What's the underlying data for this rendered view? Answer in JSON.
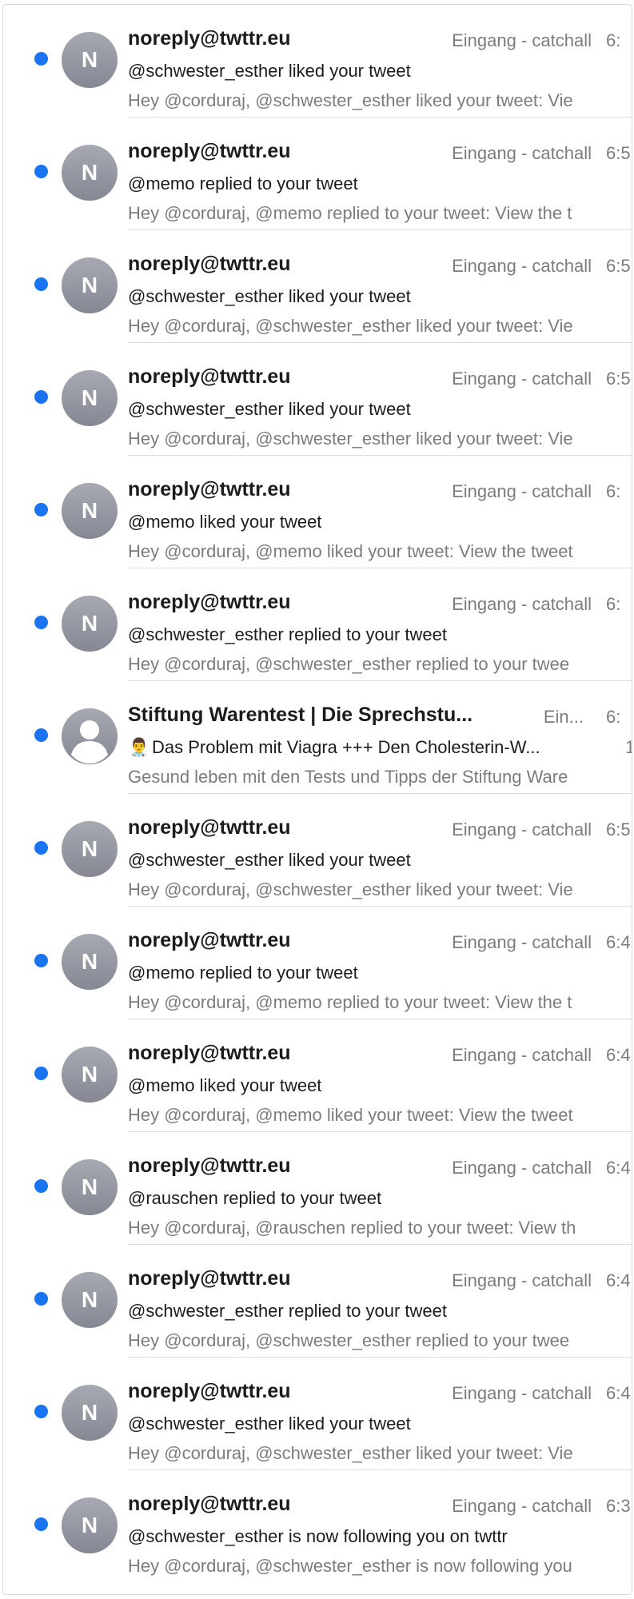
{
  "messages": [
    {
      "sender": "noreply@twttr.eu",
      "mailbox": "Eingang - catchall",
      "time": "6:",
      "subject": "@schwester_esther liked your tweet",
      "preview": "Hey @corduraj, @schwester_esther liked your tweet: Vie",
      "avatar_initial": "N",
      "unread": true
    },
    {
      "sender": "noreply@twttr.eu",
      "mailbox": "Eingang - catchall",
      "time": "6:5",
      "subject": "@memo replied to your tweet",
      "preview": "Hey @corduraj, @memo replied to your tweet: View the t",
      "avatar_initial": "N",
      "unread": true
    },
    {
      "sender": "noreply@twttr.eu",
      "mailbox": "Eingang - catchall",
      "time": "6:5",
      "subject": "@schwester_esther liked your tweet",
      "preview": "Hey @corduraj, @schwester_esther liked your tweet: Vie",
      "avatar_initial": "N",
      "unread": true
    },
    {
      "sender": "noreply@twttr.eu",
      "mailbox": "Eingang - catchall",
      "time": "6:5",
      "subject": "@schwester_esther liked your tweet",
      "preview": "Hey @corduraj, @schwester_esther liked your tweet: Vie",
      "avatar_initial": "N",
      "unread": true
    },
    {
      "sender": "noreply@twttr.eu",
      "mailbox": "Eingang - catchall",
      "time": "6:",
      "subject": "@memo liked your tweet",
      "preview": "Hey @corduraj, @memo liked your tweet: View the tweet",
      "avatar_initial": "N",
      "unread": true
    },
    {
      "sender": "noreply@twttr.eu",
      "mailbox": "Eingang - catchall",
      "time": "6:",
      "subject": "@schwester_esther replied to your tweet",
      "preview": "Hey @corduraj, @schwester_esther replied to your twee",
      "avatar_initial": "N",
      "unread": true
    },
    {
      "sender": "Stiftung Warentest | Die Sprechstu...",
      "mailbox": "Ein...",
      "time": "6:",
      "subject": "Das Problem mit Viagra +++ Den Cholesterin-W...",
      "subject_emoji": "👨‍⚕️",
      "count": "1",
      "preview": "Gesund leben mit den Tests und Tipps der Stiftung Ware",
      "avatar_initial": "",
      "avatar_type": "person-icon",
      "unread": true
    },
    {
      "sender": "noreply@twttr.eu",
      "mailbox": "Eingang - catchall",
      "time": "6:5",
      "subject": "@schwester_esther liked your tweet",
      "preview": "Hey @corduraj, @schwester_esther liked your tweet: Vie",
      "avatar_initial": "N",
      "unread": true
    },
    {
      "sender": "noreply@twttr.eu",
      "mailbox": "Eingang - catchall",
      "time": "6:4",
      "subject": "@memo replied to your tweet",
      "preview": "Hey @corduraj, @memo replied to your tweet: View the t",
      "avatar_initial": "N",
      "unread": true
    },
    {
      "sender": "noreply@twttr.eu",
      "mailbox": "Eingang - catchall",
      "time": "6:4",
      "subject": "@memo liked your tweet",
      "preview": "Hey @corduraj, @memo liked your tweet: View the tweet",
      "avatar_initial": "N",
      "unread": true
    },
    {
      "sender": "noreply@twttr.eu",
      "mailbox": "Eingang - catchall",
      "time": "6:4",
      "subject": "@rauschen replied to your tweet",
      "preview": "Hey @corduraj, @rauschen replied to your tweet: View th",
      "avatar_initial": "N",
      "unread": true
    },
    {
      "sender": "noreply@twttr.eu",
      "mailbox": "Eingang - catchall",
      "time": "6:4",
      "subject": "@schwester_esther replied to your tweet",
      "preview": "Hey @corduraj, @schwester_esther replied to your twee",
      "avatar_initial": "N",
      "unread": true
    },
    {
      "sender": "noreply@twttr.eu",
      "mailbox": "Eingang - catchall",
      "time": "6:4",
      "subject": "@schwester_esther liked your tweet",
      "preview": "Hey @corduraj, @schwester_esther liked your tweet: Vie",
      "avatar_initial": "N",
      "unread": true
    },
    {
      "sender": "noreply@twttr.eu",
      "mailbox": "Eingang - catchall",
      "time": "6:3",
      "subject": "@schwester_esther is now following you on twttr",
      "preview": "Hey @corduraj, @schwester_esther is now following you",
      "avatar_initial": "N",
      "unread": true
    }
  ],
  "colors": {
    "unread_dot": "#1a73f0",
    "avatar": "#979aa3",
    "sender": "#1c1c1e",
    "secondary": "#7c7c80",
    "separator": "#dcdcdc"
  }
}
